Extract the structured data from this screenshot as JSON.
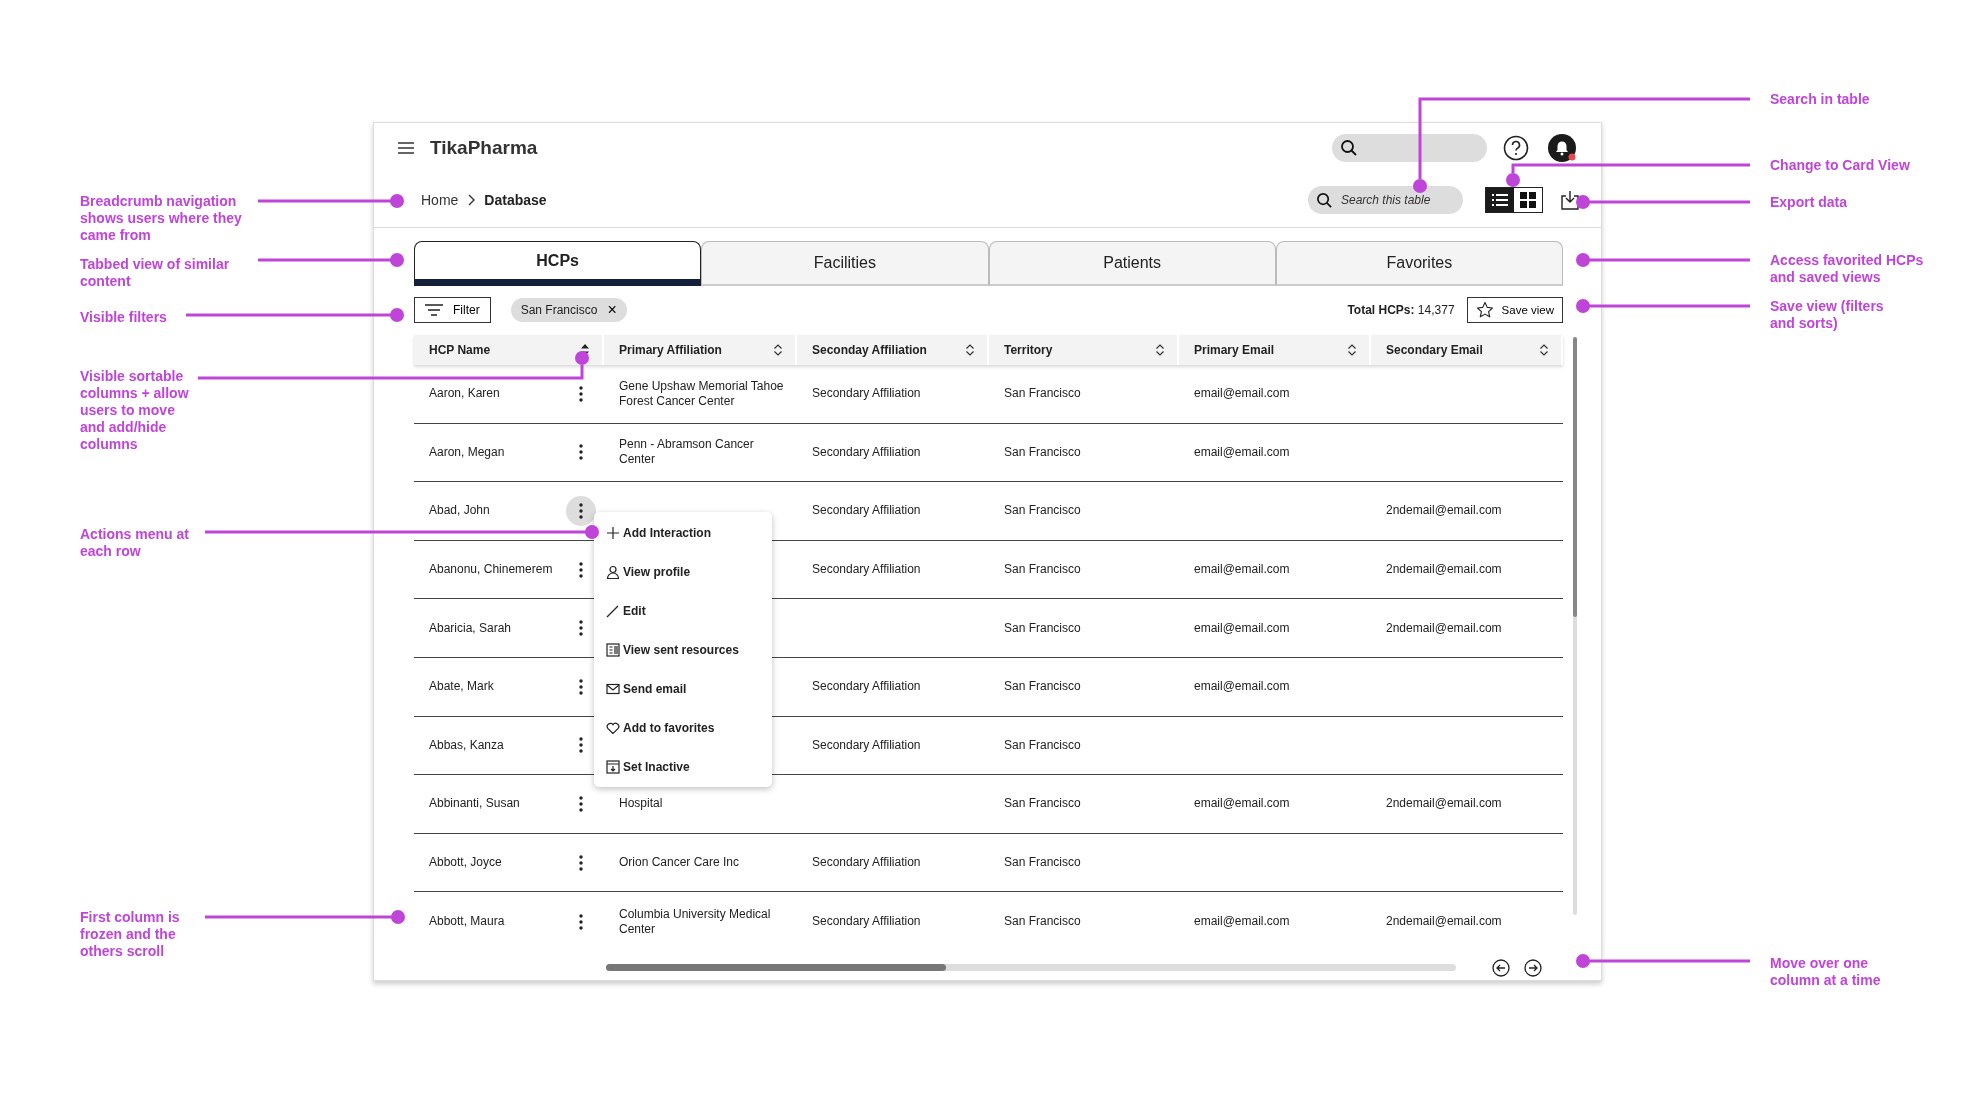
{
  "app": {
    "title": "TikaPharma"
  },
  "breadcrumb": [
    {
      "label": "Home",
      "current": false
    },
    {
      "label": "Database",
      "current": true
    }
  ],
  "table_search": {
    "placeholder": "Search this table"
  },
  "views": [
    {
      "kind": "list",
      "selected": true
    },
    {
      "kind": "grid",
      "selected": false
    }
  ],
  "tabs": [
    {
      "label": "HCPs",
      "selected": true
    },
    {
      "label": "Facilities",
      "selected": false
    },
    {
      "label": "Patients",
      "selected": false
    },
    {
      "label": "Favorites",
      "selected": false
    }
  ],
  "filter_button": "Filter",
  "filters": [
    {
      "label": "San Francisco",
      "remove": "×"
    }
  ],
  "total": {
    "label": "Total HCPs:",
    "value": "14,377"
  },
  "save_view": "Save view",
  "columns": [
    {
      "label": "HCP Name",
      "sorted": true
    },
    {
      "label": "Primary Affiliation",
      "sorted": false
    },
    {
      "label": "Seconday Affiliation",
      "sorted": false
    },
    {
      "label": "Territory",
      "sorted": false
    },
    {
      "label": "Primary Email",
      "sorted": false
    },
    {
      "label": "Secondary Email",
      "sorted": false
    }
  ],
  "rows": [
    {
      "name": "Aaron, Karen",
      "menu_open": false,
      "primary_affiliation": "Gene Upshaw Memorial Tahoe Forest Cancer Center",
      "secondary_affiliation": "Secondary Affiliation",
      "territory": "San Francisco",
      "primary_email": "email@email.com"
    },
    {
      "name": "Aaron, Megan",
      "menu_open": false,
      "primary_affiliation": "Penn - Abramson Cancer Center",
      "secondary_affiliation": "Secondary Affiliation",
      "territory": "San Francisco",
      "primary_email": "email@email.com"
    },
    {
      "name": "Abad, John",
      "menu_open": true,
      "secondary_affiliation": "Secondary Affiliation",
      "territory": "San Francisco",
      "secondary_email": "2ndemail@email.com"
    },
    {
      "name": "Abanonu, Chinemerem",
      "menu_open": false,
      "secondary_affiliation": "Secondary Affiliation",
      "territory": "San Francisco",
      "primary_email": "email@email.com",
      "secondary_email": "2ndemail@email.com"
    },
    {
      "name": "Abaricia, Sarah",
      "menu_open": false,
      "territory": "San Francisco",
      "primary_email": "email@email.com",
      "secondary_email": "2ndemail@email.com"
    },
    {
      "name": "Abate, Mark",
      "menu_open": false,
      "secondary_affiliation": "Secondary Affiliation",
      "territory": "San Francisco",
      "primary_email": "email@email.com"
    },
    {
      "name": "Abbas, Kanza",
      "menu_open": false,
      "secondary_affiliation": "Secondary Affiliation",
      "territory": "San Francisco"
    },
    {
      "name": "Abbinanti, Susan",
      "menu_open": false,
      "primary_affiliation": "Hospital",
      "territory": "San Francisco",
      "primary_email": "email@email.com",
      "secondary_email": "2ndemail@email.com"
    },
    {
      "name": "Abbott, Joyce",
      "menu_open": false,
      "primary_affiliation": "Orion Cancer Care Inc",
      "secondary_affiliation": "Secondary Affiliation",
      "territory": "San Francisco"
    },
    {
      "name": "Abbott, Maura",
      "menu_open": false,
      "primary_affiliation": "Columbia University Medical Center",
      "secondary_affiliation": "Secondary Affiliation",
      "territory": "San Francisco",
      "primary_email": "email@email.com",
      "secondary_email": "2ndemail@email.com"
    }
  ],
  "actions_menu": [
    {
      "kind": "plus",
      "label": "Add Interaction"
    },
    {
      "kind": "person",
      "label": "View profile"
    },
    {
      "kind": "pencil",
      "label": "Edit"
    },
    {
      "kind": "document",
      "label": "View sent resources"
    },
    {
      "kind": "mail",
      "label": "Send email"
    },
    {
      "kind": "heart",
      "label": "Add to favorites"
    },
    {
      "kind": "archive",
      "label": "Set Inactive"
    }
  ],
  "annotations_left": [
    "Breadcrumb navigation shows users where they came from",
    "Tabbed view of similar content",
    "Visible filters",
    "Visible sortable columns + allow users to move and add/hide columns",
    "Actions menu at each row",
    "First column is frozen and the others scroll"
  ],
  "annotations_right": [
    "Search in table",
    "Change to Card View",
    "Export data",
    "Access favorited HCPs and saved views",
    "Save view (filters and sorts)",
    "Move over one column at a time"
  ]
}
